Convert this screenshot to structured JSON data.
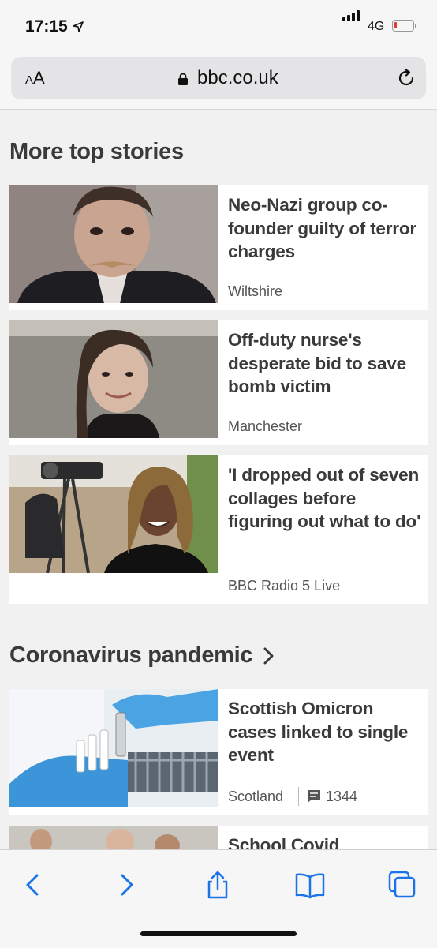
{
  "status": {
    "time": "17:15",
    "network": "4G"
  },
  "browser": {
    "text_size_small": "A",
    "text_size_large": "A",
    "url": "bbc.co.uk"
  },
  "sections": [
    {
      "title": "More top stories"
    },
    {
      "title": "Coronavirus pandemic"
    }
  ],
  "stories": [
    {
      "headline": "Neo-Nazi group co-founder guilty of terror charges",
      "tag": "Wiltshire"
    },
    {
      "headline": "Off-duty nurse's desperate bid to save bomb victim",
      "tag": "Manchester"
    },
    {
      "headline": "'I dropped out of seven collages before figuring out what to do'",
      "tag": "BBC Radio 5 Live"
    },
    {
      "headline": "Scottish Omicron cases linked to single event",
      "tag": "Scotland",
      "comments": "1344"
    },
    {
      "headline": "School Covid"
    }
  ],
  "icons": [
    "location-arrow-icon",
    "signal-icon",
    "battery-icon",
    "lock-icon",
    "reload-icon",
    "chevron-right-icon",
    "comment-icon",
    "back-icon",
    "forward-icon",
    "share-icon",
    "bookmarks-icon",
    "tabs-icon"
  ]
}
